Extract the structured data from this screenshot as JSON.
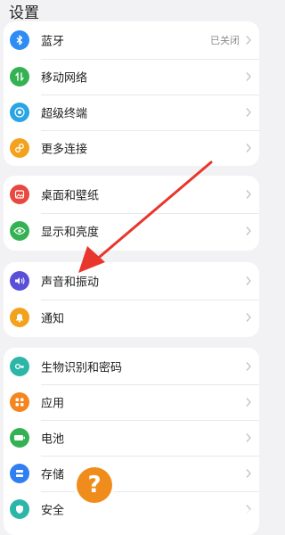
{
  "header": {
    "title": "设置"
  },
  "groups": [
    {
      "items": [
        {
          "label": "蓝牙",
          "value": "已关闭",
          "icon": "bluetooth-icon",
          "color": "#2f8cf3"
        },
        {
          "label": "移动网络",
          "icon": "signal-icon",
          "color": "#34b253"
        },
        {
          "label": "超级终端",
          "icon": "super-device-icon",
          "color": "#29a4e4"
        },
        {
          "label": "更多连接",
          "icon": "link-icon",
          "color": "#f3a21d"
        }
      ]
    },
    {
      "items": [
        {
          "label": "桌面和壁纸",
          "icon": "wallpaper-icon",
          "color": "#e8483e"
        },
        {
          "label": "显示和亮度",
          "icon": "eye-icon",
          "color": "#34b253"
        }
      ]
    },
    {
      "items": [
        {
          "label": "声音和振动",
          "icon": "speaker-icon",
          "color": "#5a4fd8"
        },
        {
          "label": "通知",
          "icon": "bell-icon",
          "color": "#f3a21d"
        }
      ]
    },
    {
      "items": [
        {
          "label": "生物识别和密码",
          "icon": "key-icon",
          "color": "#2cb6a8"
        },
        {
          "label": "应用",
          "icon": "apps-icon",
          "color": "#f5851e"
        },
        {
          "label": "电池",
          "icon": "battery-icon",
          "color": "#34b253"
        },
        {
          "label": "存储",
          "icon": "storage-icon",
          "color": "#2f7ff2"
        },
        {
          "label": "安全",
          "icon": "shield-icon",
          "color": "#2cb6a8"
        }
      ]
    }
  ],
  "overlay": {
    "help_glyph": "?",
    "arrow_color": "#e8362c",
    "help_color": "#f08c1c"
  }
}
